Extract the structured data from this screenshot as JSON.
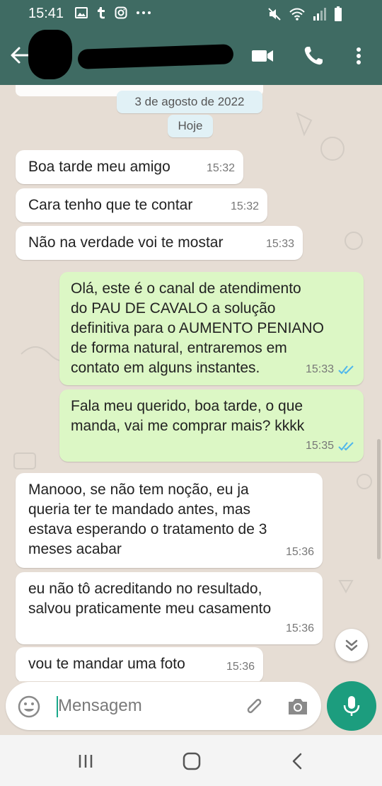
{
  "status_bar": {
    "time": "15:41",
    "left_icons": [
      "gallery-icon",
      "tumblr-icon",
      "instagram-icon",
      "more-dots-icon"
    ],
    "right_icons": [
      "mute-icon",
      "wifi-icon",
      "signal-icon",
      "battery-icon"
    ]
  },
  "header": {
    "contact_name": "",
    "actions": [
      "video-call-icon",
      "voice-call-icon",
      "menu-icon"
    ]
  },
  "chat": {
    "date_separator": "3 de agosto de 2022",
    "day_separator": "Hoje",
    "messages": [
      {
        "direction": "in",
        "text": "Boa tarde meu amigo",
        "time": "15:32"
      },
      {
        "direction": "in",
        "text": "Cara tenho que te contar",
        "time": "15:32"
      },
      {
        "direction": "in",
        "text": "Não na verdade voi te mostar",
        "time": "15:33"
      },
      {
        "direction": "out",
        "text": "Olá, este é o canal de atendimento\ndo PAU DE CAVALO a solução\ndefinitiva para o AUMENTO PENIANO\nde forma natural, entraremos em\ncontato em alguns instantes.",
        "time": "15:33",
        "status": "read"
      },
      {
        "direction": "out",
        "text": "Fala meu querido, boa tarde, o que\nmanda, vai me comprar mais? kkkk",
        "time": "15:35",
        "status": "read"
      },
      {
        "direction": "in",
        "text": "Manooo, se não tem noção, eu ja\nqueria ter te mandado antes, mas\nestava esperando o tratamento de 3\nmeses acabar",
        "time": "15:36"
      },
      {
        "direction": "in",
        "text": "eu não tô acreditando no resultado,\nsalvou praticamente meu casamento",
        "time": "15:36"
      },
      {
        "direction": "in",
        "text": "vou te mandar uma foto",
        "time": "15:36"
      }
    ]
  },
  "composer": {
    "placeholder": "Mensagem"
  },
  "colors": {
    "header": "#3f6b63",
    "chat_bg": "#e6ddd4",
    "incoming": "#ffffff",
    "outgoing": "#dcf7c5",
    "read_ticks": "#4fb6ec",
    "mic_button": "#1c9d7e"
  },
  "nav_bar": {
    "buttons": [
      "recent-apps-icon",
      "home-icon",
      "back-icon"
    ]
  }
}
